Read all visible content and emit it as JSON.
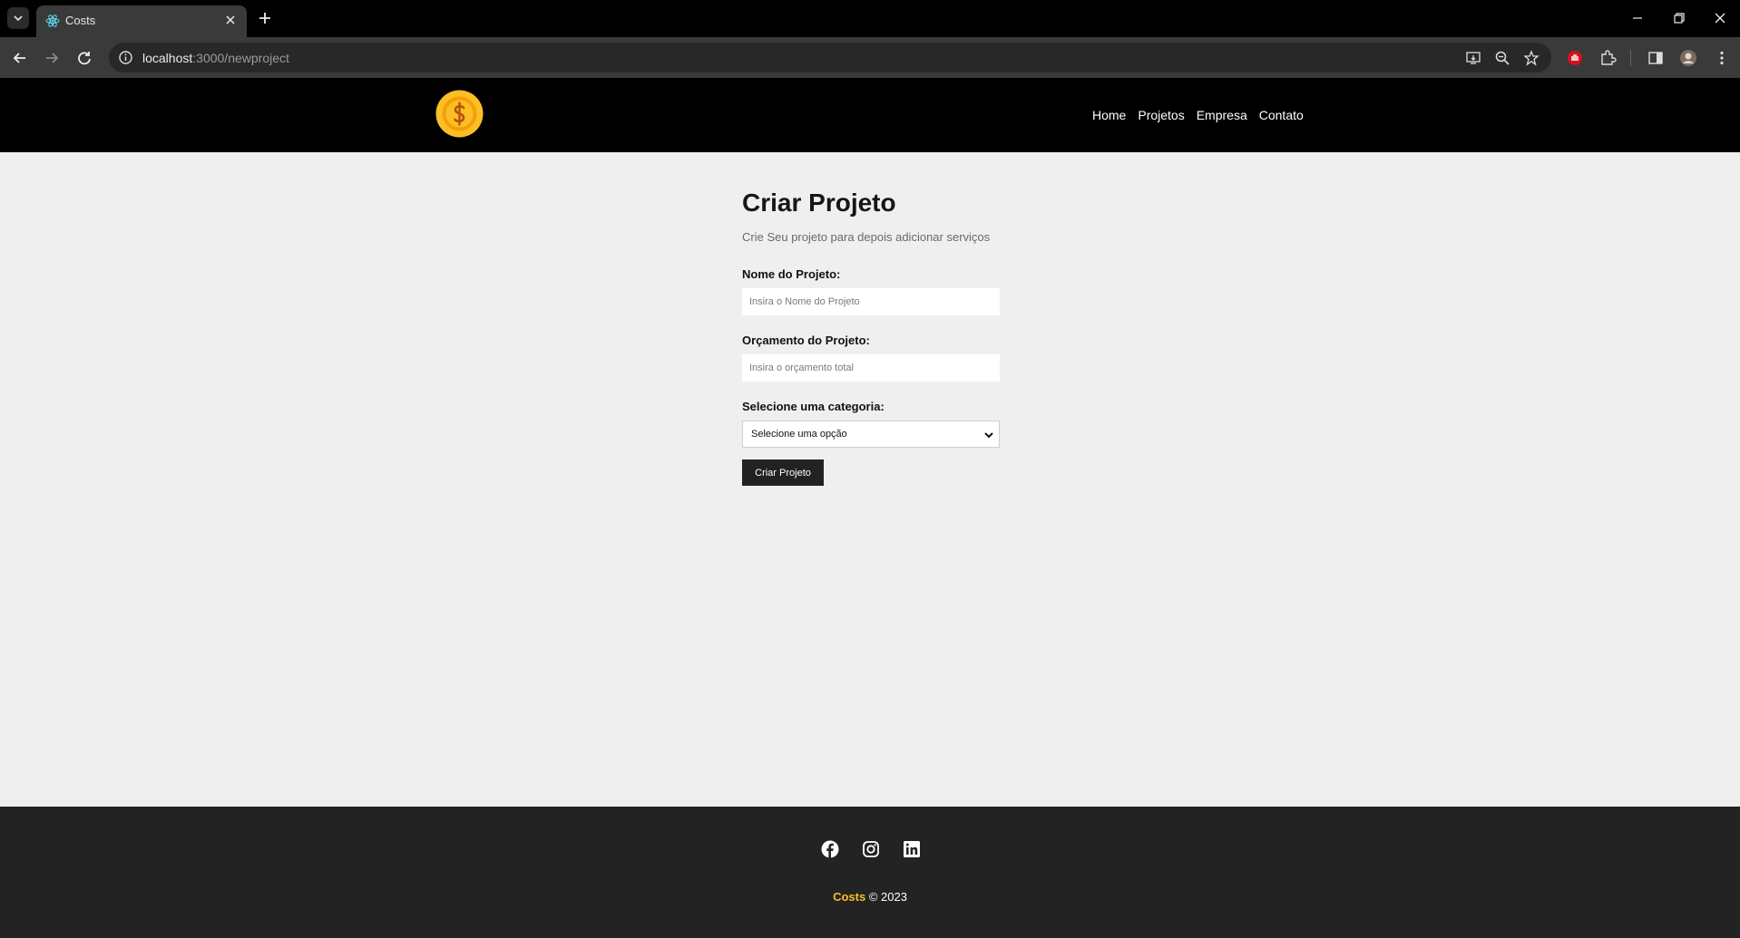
{
  "browser": {
    "tab_title": "Costs",
    "url_host": "localhost",
    "url_rest": ":3000/newproject"
  },
  "site": {
    "nav": [
      "Home",
      "Projetos",
      "Empresa",
      "Contato"
    ]
  },
  "form": {
    "title": "Criar Projeto",
    "subtitle": "Crie Seu projeto para depois adicionar serviços",
    "name_label": "Nome do Projeto:",
    "name_placeholder": "Insira o Nome do Projeto",
    "budget_label": "Orçamento do Projeto:",
    "budget_placeholder": "Insira o orçamento total",
    "category_label": "Selecione uma categoria:",
    "category_selected": "Selecione uma opção",
    "submit_label": "Criar Projeto"
  },
  "footer": {
    "brand": "Costs",
    "copyright": "© 2023",
    "social_icons": [
      "facebook-icon",
      "instagram-icon",
      "linkedin-icon"
    ]
  },
  "colors": {
    "brand_yellow": "#fbbf24",
    "header_bg": "#000000",
    "footer_bg": "#232323",
    "page_bg": "#efefef"
  }
}
